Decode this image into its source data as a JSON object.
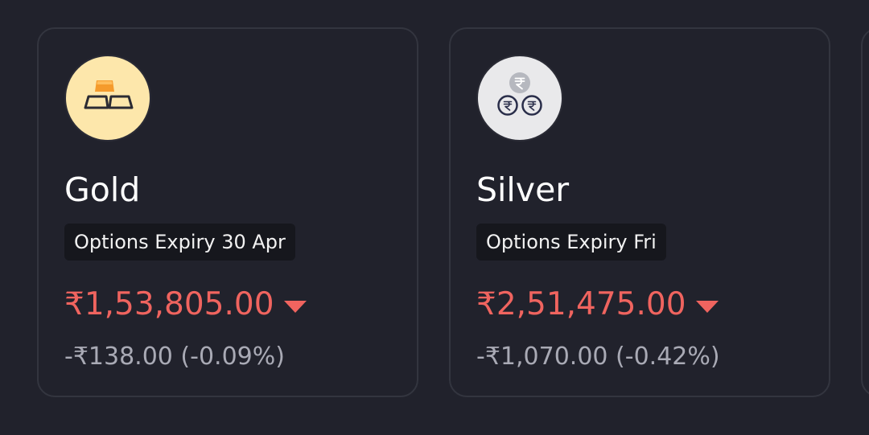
{
  "colors": {
    "background": "#21222c",
    "card_border": "#33353f",
    "badge_background": "#16171d",
    "negative": "#f0645f",
    "muted_text": "#a9aab5",
    "gold_icon_background": "#fde7ab",
    "silver_icon_background": "#e9e9eb"
  },
  "cards": [
    {
      "name": "Gold",
      "icon": "gold-bars-icon",
      "expiry": "Options Expiry 30 Apr",
      "price": "₹1,53,805.00",
      "trend_icon": "caret-down-icon",
      "change": "-₹138.00 (-0.09%)"
    },
    {
      "name": "Silver",
      "icon": "rupee-coins-icon",
      "expiry": "Options Expiry Fri",
      "price": "₹2,51,475.00",
      "trend_icon": "caret-down-icon",
      "change": "-₹1,070.00 (-0.42%)"
    }
  ]
}
